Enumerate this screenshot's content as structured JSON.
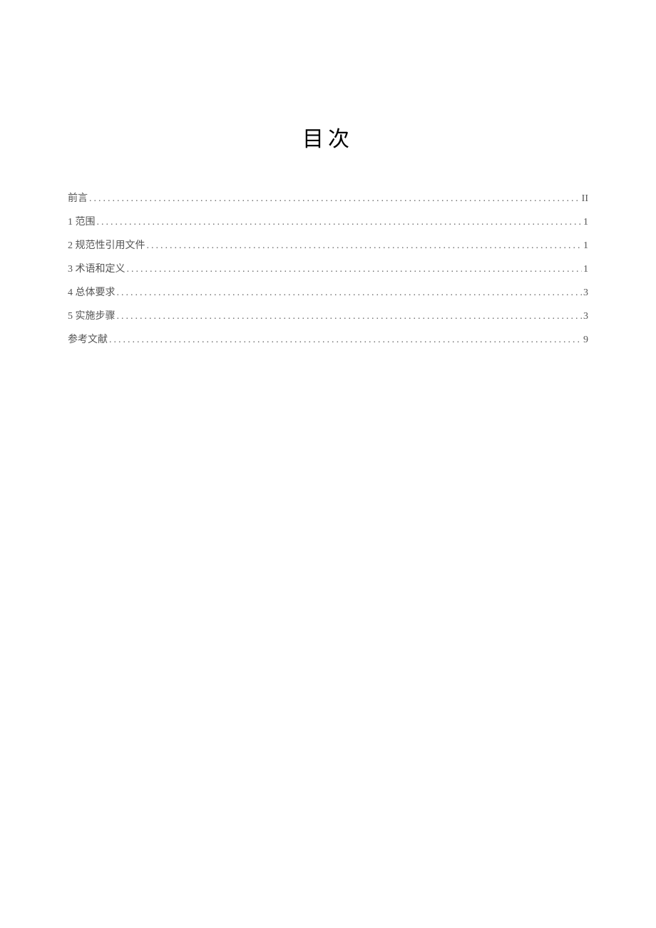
{
  "title": "目次",
  "toc": [
    {
      "label": "前言",
      "page": "II"
    },
    {
      "label": "1 范围",
      "page": "1"
    },
    {
      "label": "2 规范性引用文件",
      "page": "1"
    },
    {
      "label": "3 术语和定义",
      "page": "1"
    },
    {
      "label": "4 总体要求",
      "page": "3"
    },
    {
      "label": "5 实施步骤",
      "page": "3"
    },
    {
      "label": "参考文献",
      "page": "9"
    }
  ]
}
